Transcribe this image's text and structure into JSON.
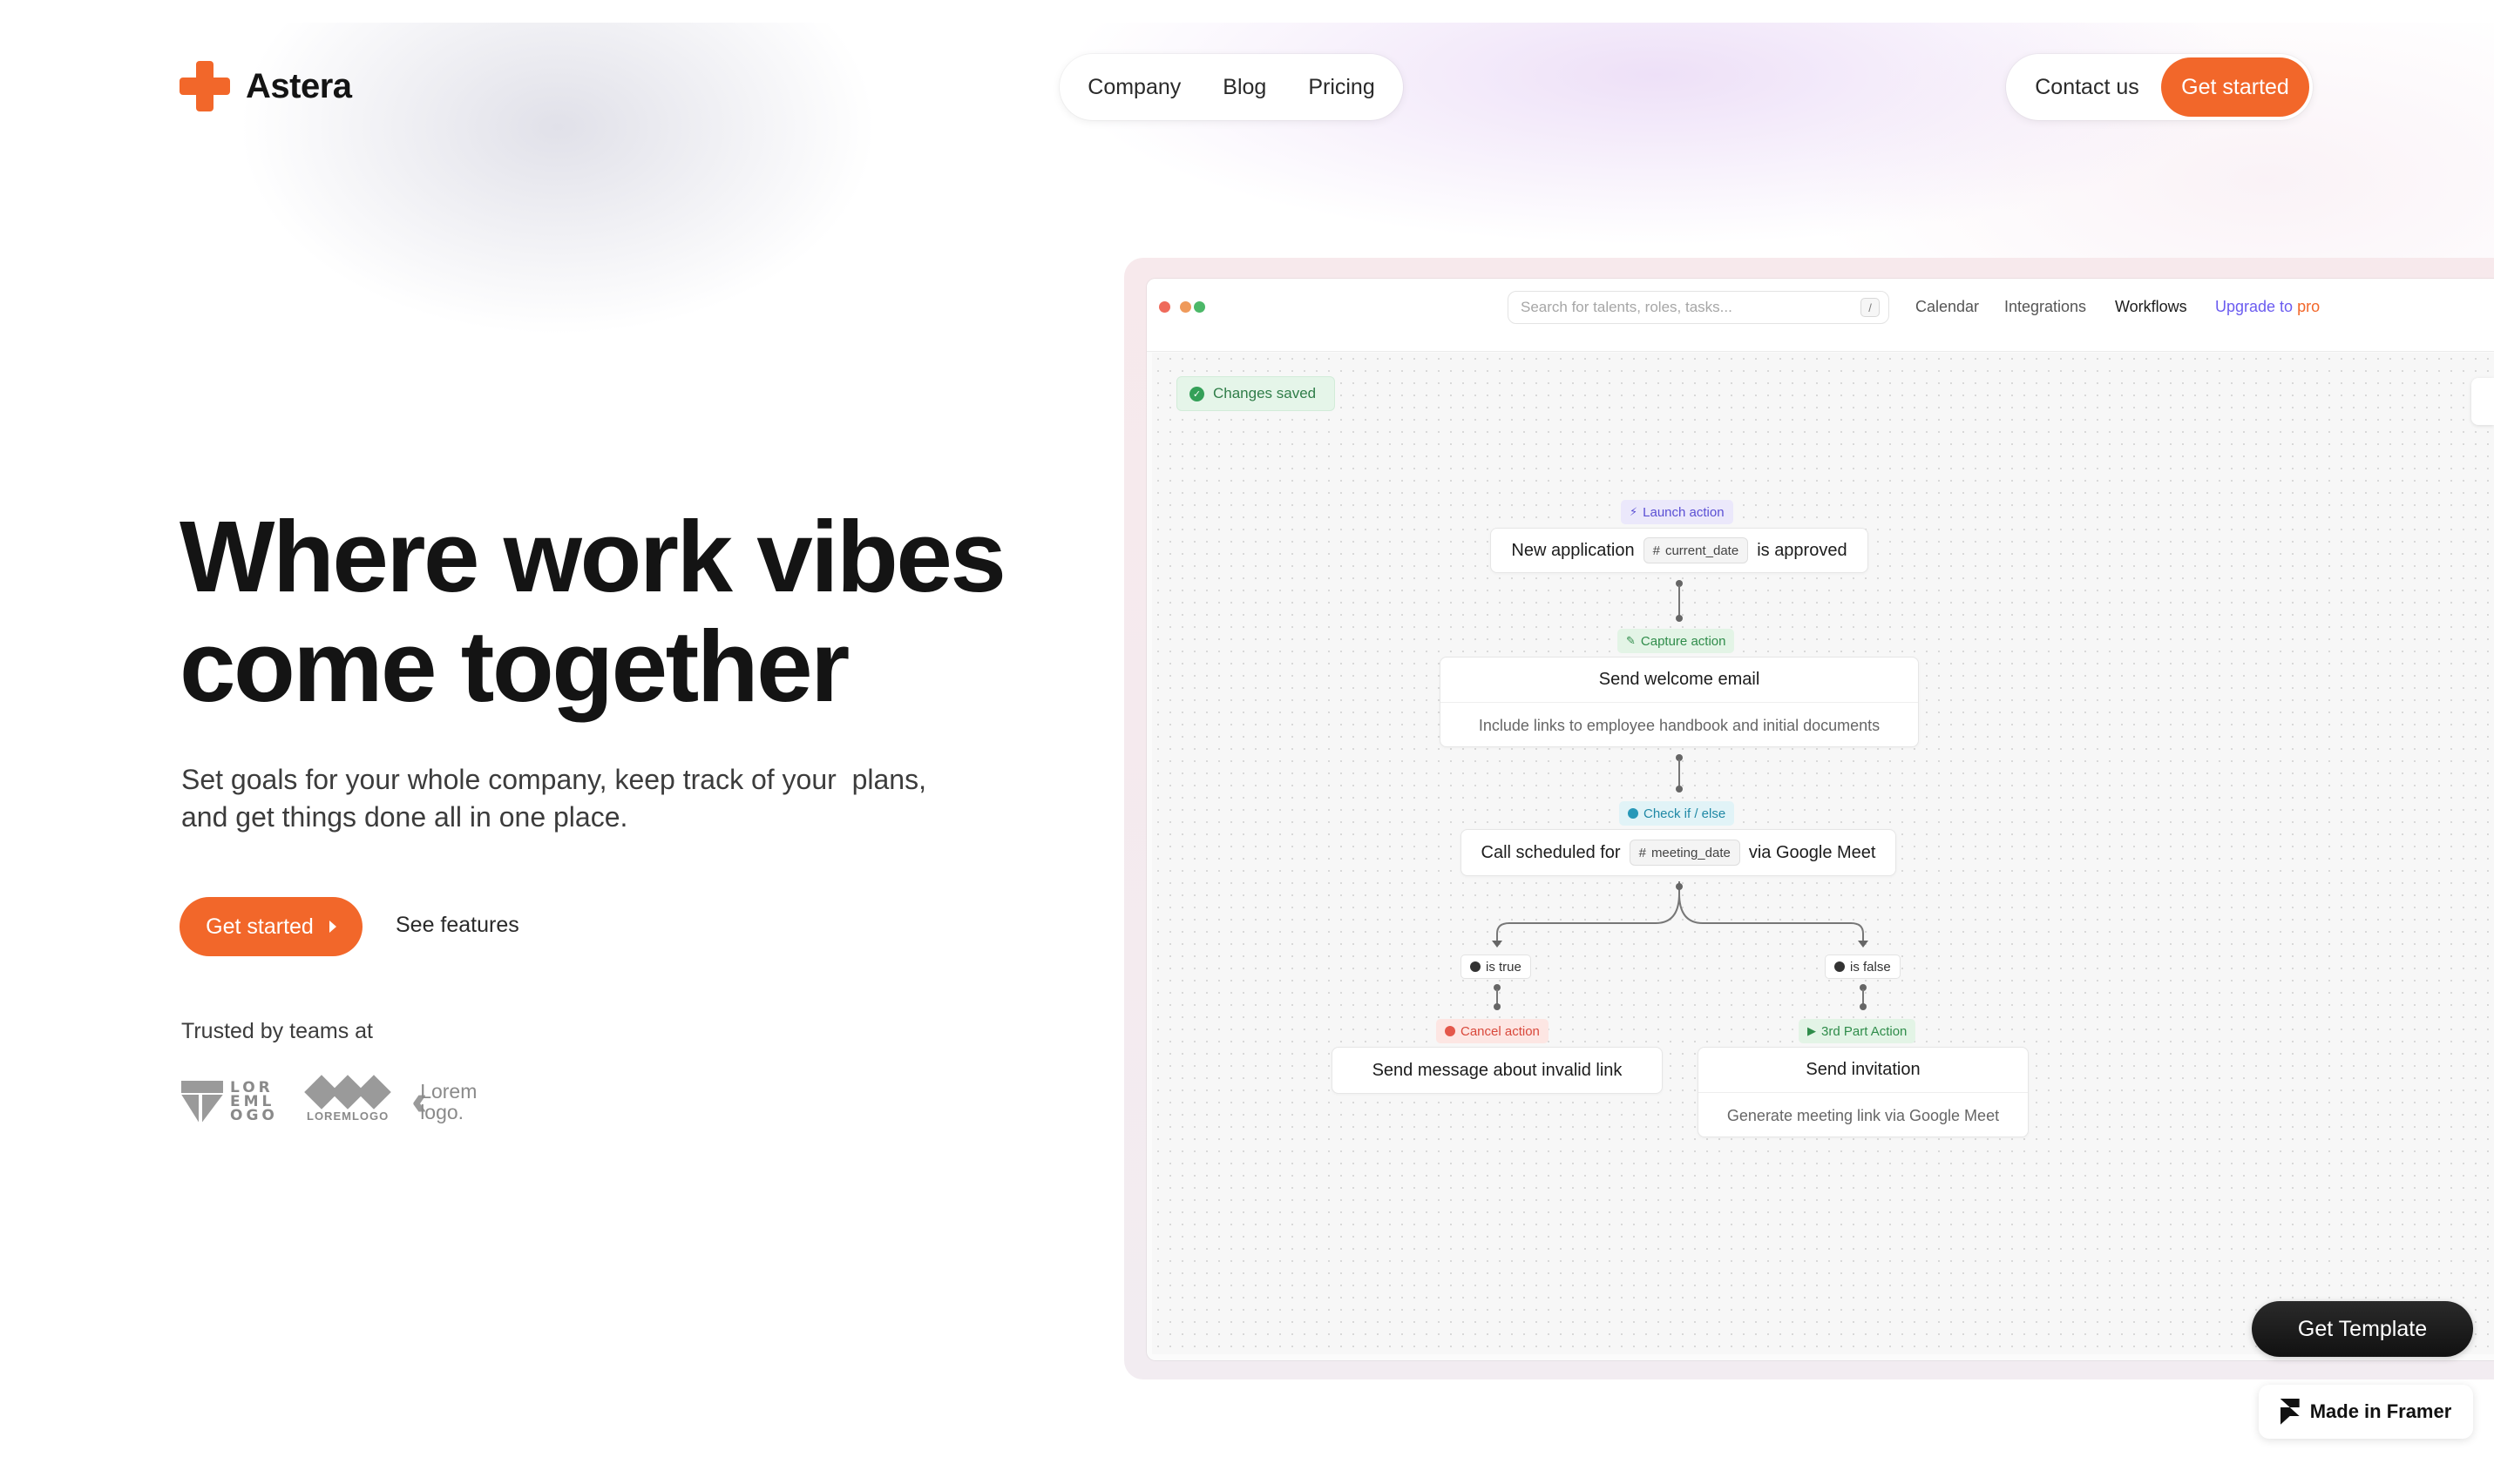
{
  "brand": {
    "name": "Astera",
    "accent": "#f2672a"
  },
  "nav": {
    "links": [
      "Company",
      "Blog",
      "Pricing"
    ],
    "contact_label": "Contact us",
    "cta_label": "Get started"
  },
  "hero": {
    "title_line1": "Where work vibes",
    "title_line2": "come together",
    "subtitle_line1": "Set goals for your whole company, keep track of your  plans,",
    "subtitle_line2": "and get things done all in one place.",
    "primary_label": "Get started",
    "secondary_label": "See features",
    "trusted_label": "Trusted by teams at",
    "logos": [
      {
        "text": "LOR EML OGO"
      },
      {
        "text": "LOREMLOGO"
      },
      {
        "text": "Lorem logo."
      }
    ]
  },
  "app": {
    "search_placeholder": "Search for talents, roles, tasks...",
    "search_shortcut": "/",
    "nav": [
      "Calendar",
      "Integrations",
      "Workflows"
    ],
    "active_nav": "Workflows",
    "upgrade_prefix": "Upgrade to",
    "upgrade_suffix": "pro",
    "saved_label": "Changes saved",
    "workflow": {
      "launch_tag": "Launch action",
      "launch_before": "New application",
      "launch_var": "current_date",
      "launch_after": "is approved",
      "capture_tag": "Capture action",
      "capture_title": "Send welcome email",
      "capture_desc": "Include links to employee handbook and initial documents",
      "check_tag": "Check if / else",
      "check_before": "Call scheduled for",
      "check_var": "meeting_date",
      "check_after": "via Google Meet",
      "true_label": "is true",
      "false_label": "is false",
      "cancel_tag": "Cancel action",
      "cancel_title": "Send message about invalid link",
      "third_tag": "3rd Part Action",
      "third_title": "Send invitation",
      "third_desc": "Generate meeting link via Google Meet"
    }
  },
  "template_button": "Get Template",
  "framer_badge": "Made in Framer"
}
